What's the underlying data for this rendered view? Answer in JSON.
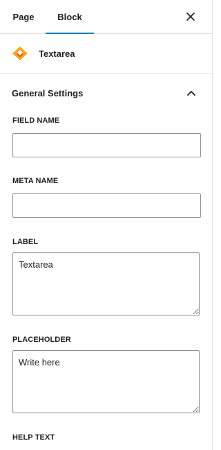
{
  "tabs": {
    "page_label": "Page",
    "block_label": "Block",
    "active": "Block"
  },
  "block": {
    "title": "Textarea",
    "icon": "block-logo-icon",
    "accent": "#f7a823"
  },
  "section": {
    "title": "General Settings",
    "expanded": true
  },
  "fields": {
    "field_name": {
      "label": "FIELD NAME",
      "value": ""
    },
    "meta_name": {
      "label": "META NAME",
      "value": ""
    },
    "label": {
      "label": "LABEL",
      "value": "Textarea"
    },
    "placeholder": {
      "label": "PLACEHOLDER",
      "value": "Write here"
    },
    "help_text": {
      "label": "HELP TEXT"
    }
  },
  "colors": {
    "tab_indicator": "#007cba",
    "border": "#e0e0e0",
    "input_border": "#8c8f94"
  }
}
